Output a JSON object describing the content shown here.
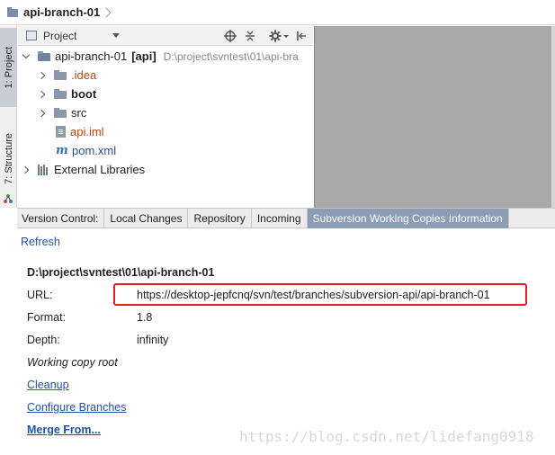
{
  "breadcrumb": {
    "title": "api-branch-01"
  },
  "left_strip": {
    "project_tab": "1: Project",
    "structure_tab": "7: Structure"
  },
  "project_panel": {
    "header_label": "Project",
    "tree": [
      {
        "name": "api-branch-01",
        "module": "[api]",
        "path": "D:\\project\\svntest\\01\\api-bra"
      },
      {
        "name": ".idea"
      },
      {
        "name": "boot"
      },
      {
        "name": "src"
      },
      {
        "name": "api.iml"
      },
      {
        "name": "pom.xml"
      },
      {
        "name": "External Libraries"
      }
    ]
  },
  "tabs": {
    "label": "Version Control:",
    "items": [
      "Local Changes",
      "Repository",
      "Incoming",
      "Subversion Working Copies Information"
    ],
    "active": "Subversion Working Copies Information"
  },
  "info": {
    "refresh": "Refresh",
    "path": "D:\\project\\svntest\\01\\api-branch-01",
    "url_label": "URL:",
    "url_value": "https://desktop-jepfcnq/svn/test/branches/subversion-api/api-branch-01",
    "format_label": "Format:",
    "format_value": "1.8",
    "depth_label": "Depth:",
    "depth_value": "infinity",
    "working_copy_root": "Working copy root",
    "cleanup": "Cleanup",
    "configure_branches": "Configure Branches",
    "merge_from": "Merge From..."
  },
  "watermark": "https://blog.csdn.net/lidefang0918",
  "colors": {
    "active_tab": "#8a9db5",
    "highlight_box": "#e02020",
    "link": "#2450a8"
  }
}
